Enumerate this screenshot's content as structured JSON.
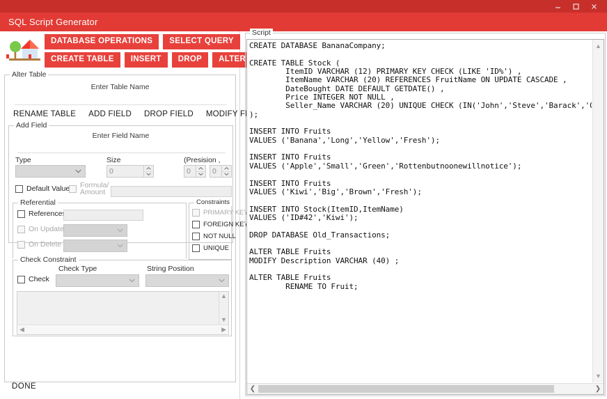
{
  "window": {
    "title": "SQL Script Generator",
    "controls": [
      {
        "name": "minimize-button",
        "glyph": "minimize"
      },
      {
        "name": "maximize-button",
        "glyph": "maximize"
      },
      {
        "name": "close-button",
        "glyph": "close"
      }
    ]
  },
  "colors": {
    "titlebar": "#c62f2a",
    "appbar": "#e23a34",
    "button_red": "#e8413c",
    "panel_bg": "#ffffff",
    "control_gray": "#d9d9d9"
  },
  "toolbar": {
    "logo_icon": "house-tree-icon",
    "row1": [
      {
        "label": "DATABASE OPERATIONS",
        "name": "database-operations-button"
      },
      {
        "label": "SELECT QUERY",
        "name": "select-query-button"
      }
    ],
    "row2": [
      {
        "label": "CREATE TABLE",
        "name": "create-table-button"
      },
      {
        "label": "INSERT",
        "name": "insert-button"
      },
      {
        "label": "DROP",
        "name": "drop-button"
      },
      {
        "label": "ALTER TABLE",
        "name": "alter-table-button"
      }
    ]
  },
  "alter_table": {
    "group_title": "Alter Table",
    "table_name_label": "Enter Table Name",
    "table_name_value": "",
    "actions": [
      {
        "label": "RENAME TABLE",
        "name": "rename-table-action"
      },
      {
        "label": "ADD FIELD",
        "name": "add-field-action"
      },
      {
        "label": "DROP FIELD",
        "name": "drop-field-action"
      },
      {
        "label": "MODIFY FIELD",
        "name": "modify-field-action"
      }
    ]
  },
  "add_field": {
    "group_title": "Add Field",
    "field_name_label": "Enter Field Name",
    "field_name_value": "",
    "type_label": "Type",
    "type_value": "",
    "size_label": "Size",
    "size_value": "0",
    "precision_label": "(Presision , Scale)",
    "precision_value": "0",
    "scale_value": "0",
    "default_value_label": "Default Value",
    "default_value_checked": false,
    "formula_label": "Formula/\nAmount",
    "formula_label_line1": "Formula/",
    "formula_label_line2": "Amount",
    "formula_checked": false,
    "formula_input_value": ""
  },
  "referential": {
    "group_title": "Referential",
    "references_label": "References",
    "references_value": "",
    "on_update_label": "On Update",
    "on_update_value": "",
    "on_delete_label": "On Delete",
    "on_delete_value": ""
  },
  "constraints": {
    "group_title": "Constraints",
    "items": [
      {
        "label": "PRIMARY KEY",
        "name": "primary-key-checkbox",
        "disabled": true,
        "checked": false
      },
      {
        "label": "FOREIGN KEY",
        "name": "foreign-key-checkbox",
        "disabled": false,
        "checked": false
      },
      {
        "label": "NOT NULL",
        "name": "not-null-checkbox",
        "disabled": false,
        "checked": false
      },
      {
        "label": "UNIQUE",
        "name": "unique-checkbox",
        "disabled": false,
        "checked": false
      }
    ]
  },
  "check_constraint": {
    "group_title": "Check Constraint",
    "check_label": "Check",
    "check_checked": false,
    "check_type_label": "Check Type",
    "check_type_value": "",
    "string_position_label": "String Position",
    "string_position_value": "",
    "textarea_value": ""
  },
  "footer": {
    "done_label": "DONE"
  },
  "script_panel": {
    "group_title": "Script",
    "content": "CREATE DATABASE BananaCompany;\n\nCREATE TABLE Stock (\n        ItemID VARCHAR (12) PRIMARY KEY CHECK (LIKE 'ID%') ,\n        ItemName VARCHAR (20) REFERENCES FruitName ON UPDATE CASCADE ,\n        DateBought DATE DEFAULT GETDATE() ,\n        Price INTEGER NOT NULL ,\n        Seller_Name VARCHAR (20) UNIQUE CHECK (IN('John','Steve','Barack','Obama','B\n);\n\nINSERT INTO Fruits\nVALUES ('Banana','Long','Yellow','Fresh');\n\nINSERT INTO Fruits\nVALUES ('Apple','Small','Green','Rottenbutnoonewillnotice');\n\nINSERT INTO Fruits\nVALUES ('Kiwi','Big','Brown','Fresh');\n\nINSERT INTO Stock(ItemID,ItemName)\nVALUES ('ID#42','Kiwi');\n\nDROP DATABASE Old_Transactions;\n\nALTER TABLE Fruits\nMODIFY Description VARCHAR (40) ;\n\nALTER TABLE Fruits\n        RENAME TO Fruit;"
  }
}
